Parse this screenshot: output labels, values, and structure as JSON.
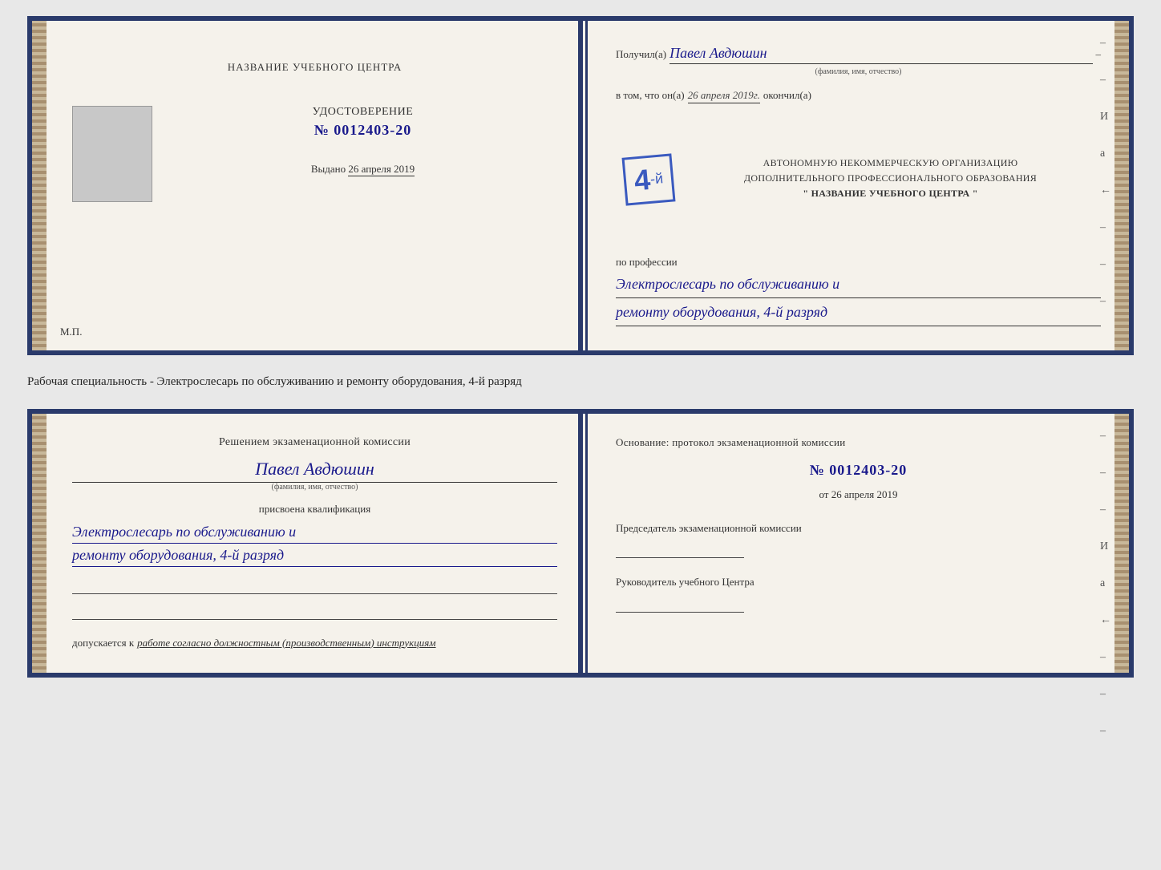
{
  "top_booklet": {
    "left": {
      "title": "НАЗВАНИЕ УЧЕБНОГО ЦЕНТРА",
      "cert_label": "УДОСТОВЕРЕНИЕ",
      "cert_prefix": "№",
      "cert_number": "0012403-20",
      "issued_label": "Выдано",
      "issued_date": "26 апреля 2019",
      "mp_label": "М.П."
    },
    "right": {
      "received_label": "Получил(а)",
      "received_name": "Павел Авдюшин",
      "fio_label": "(фамилия, имя, отчество)",
      "dash": "–",
      "v_tom_label": "в том, что он(а)",
      "date_value": "26 апреля 2019г.",
      "okonchil_label": "окончил(а)",
      "stamp_grade": "4",
      "stamp_suffix": "-й",
      "org_line1": "АВТОНОМНУЮ НЕКОММЕРЧЕСКУЮ ОРГАНИЗАЦИЮ",
      "org_line2": "ДОПОЛНИТЕЛЬНОГО ПРОФЕССИОНАЛЬНОГО ОБРАЗОВАНИЯ",
      "org_name": "\" НАЗВАНИЕ УЧЕБНОГО ЦЕНТРА \"",
      "po_professii_label": "по профессии",
      "profession_line1": "Электрослесарь по обслуживанию и",
      "profession_line2": "ремонту оборудования, 4-й разряд"
    },
    "right_dashes": [
      "-",
      "-",
      "И",
      "а",
      "←",
      "-",
      "-",
      "-"
    ]
  },
  "description": {
    "text": "Рабочая специальность - Электрослесарь по обслуживанию и ремонту оборудования, 4-й разряд"
  },
  "bottom_booklet": {
    "left": {
      "commission_title": "Решением экзаменационной комиссии",
      "person_name": "Павел Авдюшин",
      "fio_label": "(фамилия, имя, отчество)",
      "prisvoena_label": "присвоена квалификация",
      "qualification_line1": "Электрослесарь по обслуживанию и",
      "qualification_line2": "ремонту оборудования, 4-й разряд",
      "dopuskaetsya_label": "допускается к",
      "dopuskaetsya_value": "работе согласно должностным (производственным) инструкциям"
    },
    "right": {
      "osnovanie_label": "Основание: протокол экзаменационной комиссии",
      "number_prefix": "№",
      "protocol_number": "0012403-20",
      "ot_prefix": "от",
      "ot_date": "26 апреля 2019",
      "chairman_label": "Председатель экзаменационной комиссии",
      "director_label": "Руководитель учебного Центра"
    },
    "right_dashes": [
      "-",
      "-",
      "-",
      "И",
      "а",
      "←",
      "-",
      "-",
      "-"
    ]
  }
}
